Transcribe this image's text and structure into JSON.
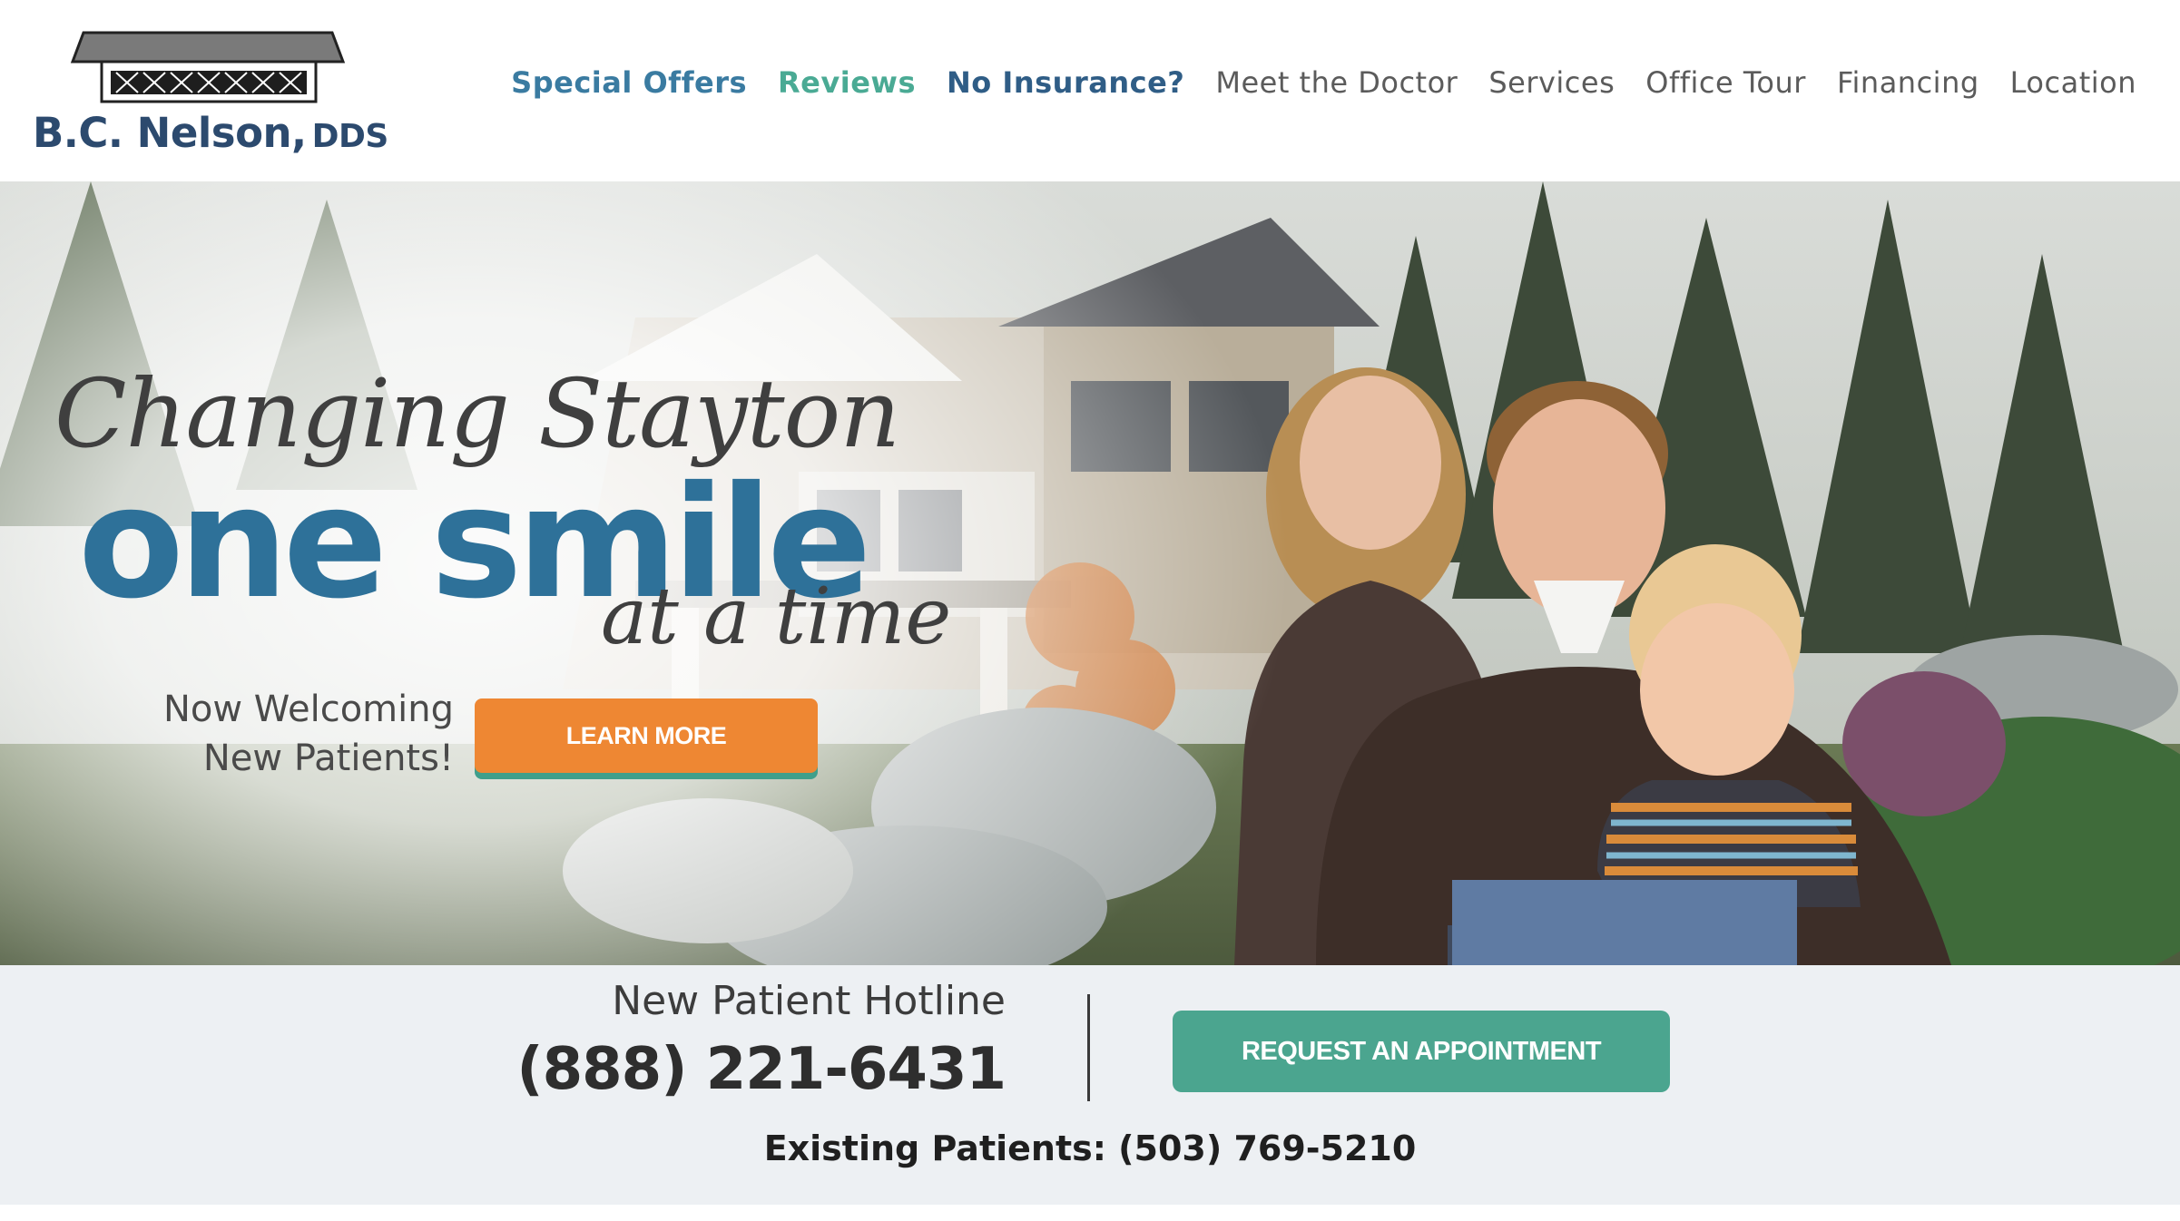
{
  "header": {
    "logo_name": "B.C. Nelson,",
    "logo_suffix": "DDS",
    "nav": [
      {
        "label": "Special Offers"
      },
      {
        "label": "Reviews"
      },
      {
        "label": "No Insurance?"
      },
      {
        "label": "Meet the Doctor"
      },
      {
        "label": "Services"
      },
      {
        "label": "Office Tour"
      },
      {
        "label": "Financing"
      },
      {
        "label": "Location"
      }
    ]
  },
  "hero": {
    "script_line": "Changing Stayton",
    "headline": "one smile",
    "tagline": "at a time",
    "welcome_line1": "Now Welcoming",
    "welcome_line2": "New Patients!",
    "cta_label": "LEARN MORE"
  },
  "contact": {
    "hotline_label": "New Patient Hotline",
    "hotline_number": "(888) 221-6431",
    "appointment_label": "REQUEST AN APPOINTMENT",
    "existing_patients": "Existing Patients: (503) 769-5210"
  },
  "colors": {
    "brand_navy": "#2c4a6e",
    "brand_blue": "#2e7199",
    "accent_orange": "#ee8733",
    "accent_teal": "#4ba58f",
    "bar_bg": "#edf0f3"
  }
}
